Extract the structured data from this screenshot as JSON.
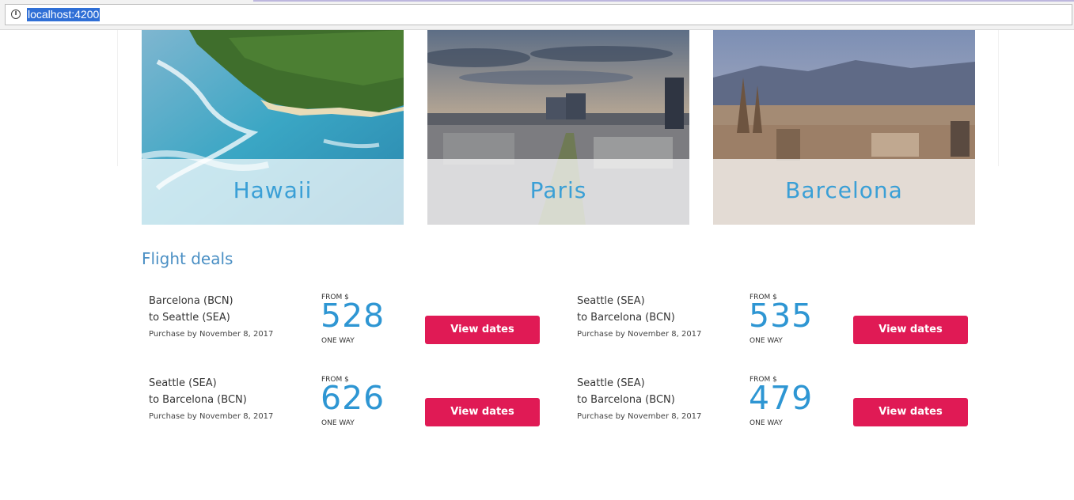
{
  "browser": {
    "url": "localhost:4200"
  },
  "destinations": [
    {
      "name": "Hawaii"
    },
    {
      "name": "Paris"
    },
    {
      "name": "Barcelona"
    }
  ],
  "flight_deals": {
    "title": "Flight deals",
    "deals": [
      {
        "from": "Barcelona (BCN)",
        "to": "to Seattle (SEA)",
        "purchase_by": "Purchase by November 8, 2017",
        "from_label": "FROM $",
        "price": "528",
        "trip_type": "ONE WAY",
        "button": "View dates"
      },
      {
        "from": "Seattle (SEA)",
        "to": "to Barcelona (BCN)",
        "purchase_by": "Purchase by November 8, 2017",
        "from_label": "FROM $",
        "price": "535",
        "trip_type": "ONE WAY",
        "button": "View dates"
      },
      {
        "from": "Seattle (SEA)",
        "to": "to Barcelona (BCN)",
        "purchase_by": "Purchase by November 8, 2017",
        "from_label": "FROM $",
        "price": "626",
        "trip_type": "ONE WAY",
        "button": "View dates"
      },
      {
        "from": "Seattle (SEA)",
        "to": "to Barcelona (BCN)",
        "purchase_by": "Purchase by November 8, 2017",
        "from_label": "FROM $",
        "price": "479",
        "trip_type": "ONE WAY",
        "button": "View dates"
      }
    ]
  },
  "colors": {
    "accent_blue": "#3a9fd6",
    "button_pink": "#e01a55",
    "heading_blue": "#4a8fc4"
  },
  "icons": {
    "page_info": "info-icon"
  }
}
